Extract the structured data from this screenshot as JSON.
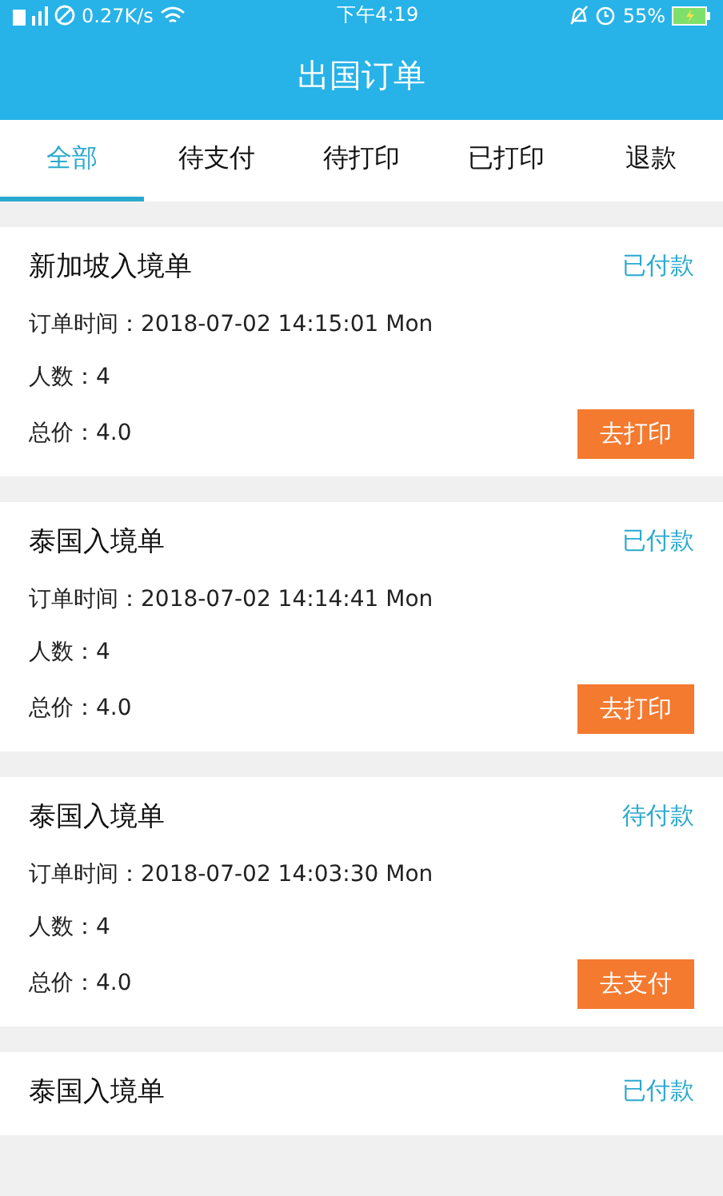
{
  "status_bar": {
    "network_speed": "0.27K/s",
    "time": "下午4:19",
    "battery": "55%"
  },
  "header": {
    "title": "出国订单"
  },
  "tabs": [
    {
      "label": "全部",
      "selected": true
    },
    {
      "label": "待支付",
      "selected": false
    },
    {
      "label": "待打印",
      "selected": false
    },
    {
      "label": "已打印",
      "selected": false
    },
    {
      "label": "退款",
      "selected": false
    }
  ],
  "orders": [
    {
      "title": "新加坡入境单",
      "status": "已付款",
      "time_label": "订单时间：",
      "time": "2018-07-02 14:15:01 Mon",
      "people_label": "人数：",
      "people": "4",
      "total_label": "总价：",
      "total": "4.0",
      "action": "去打印"
    },
    {
      "title": "泰国入境单",
      "status": "已付款",
      "time_label": "订单时间：",
      "time": "2018-07-02 14:14:41 Mon",
      "people_label": "人数：",
      "people": "4",
      "total_label": "总价：",
      "total": "4.0",
      "action": "去打印"
    },
    {
      "title": "泰国入境单",
      "status": "待付款",
      "time_label": "订单时间：",
      "time": "2018-07-02 14:03:30 Mon",
      "people_label": "人数：",
      "people": "4",
      "total_label": "总价：",
      "total": "4.0",
      "action": "去支付"
    },
    {
      "title": "泰国入境单",
      "status": "已付款"
    }
  ]
}
